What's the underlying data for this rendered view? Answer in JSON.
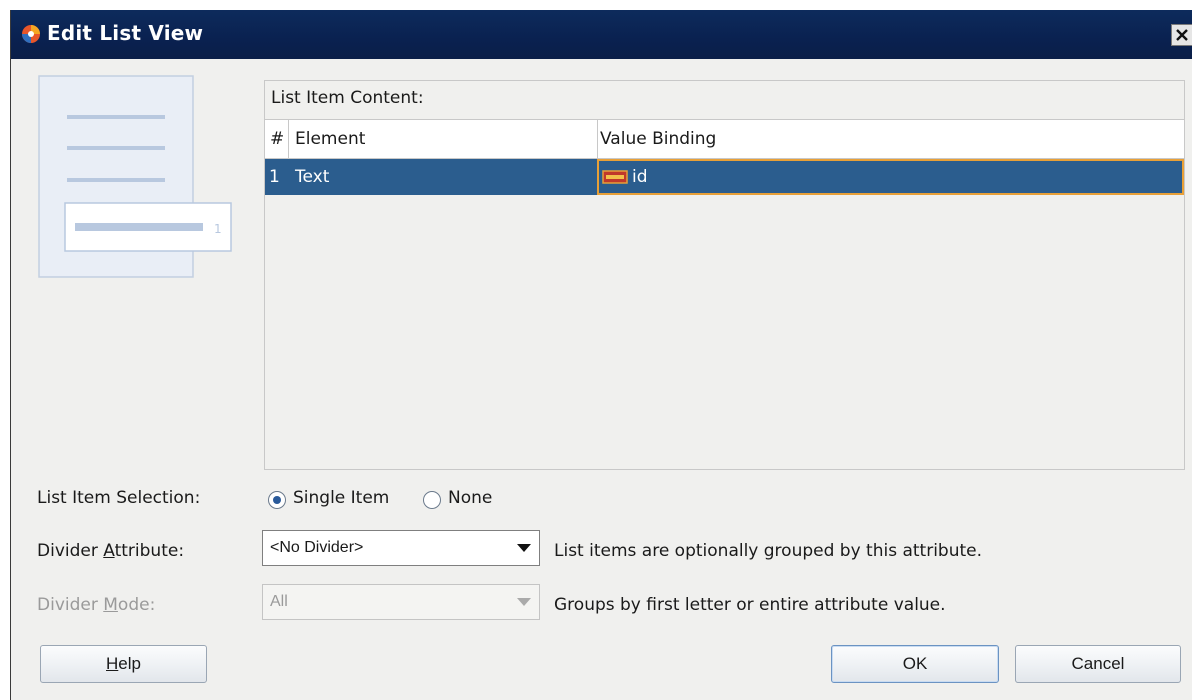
{
  "window": {
    "title": "Edit List View"
  },
  "preview": {
    "number": "1"
  },
  "table": {
    "caption": "List Item Content:",
    "columns": [
      "#",
      "Element",
      "Value Binding"
    ],
    "rows": [
      {
        "num": "1",
        "element": "Text",
        "binding": "id"
      }
    ]
  },
  "selection": {
    "label": "List Item Selection:",
    "options": [
      {
        "label": "Single Item",
        "selected": true
      },
      {
        "label": "None",
        "selected": false
      }
    ]
  },
  "divider_attribute": {
    "label_pre": "Divider ",
    "label_mnemonic": "A",
    "label_post": "ttribute:",
    "value": "<No Divider>",
    "hint": "List items are optionally grouped by this attribute."
  },
  "divider_mode": {
    "label_pre": "Divider ",
    "label_mnemonic": "M",
    "label_post": "ode:",
    "value": "All",
    "hint": "Groups by first letter or entire attribute value.",
    "enabled": false
  },
  "buttons": {
    "help_mnemonic": "H",
    "help_rest": "elp",
    "ok": "OK",
    "cancel": "Cancel"
  }
}
